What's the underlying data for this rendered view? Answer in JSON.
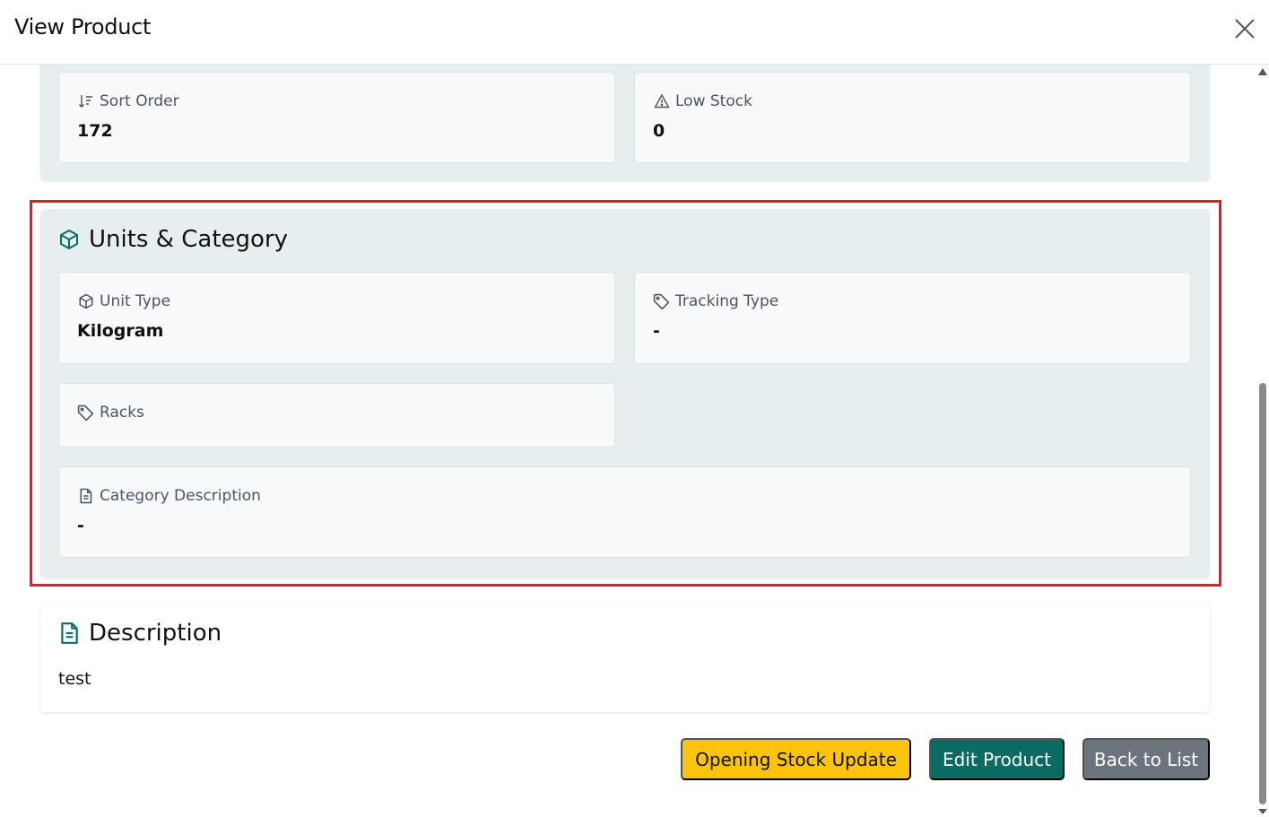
{
  "modal": {
    "title": "View Product"
  },
  "pricing_section": {
    "cards": [
      {
        "label": "Sort Order",
        "value": "172",
        "icon": "sort-icon"
      },
      {
        "label": "Low Stock",
        "value": "0",
        "icon": "warning-icon"
      }
    ]
  },
  "units_section": {
    "title": "Units & Category",
    "icon": "box-icon",
    "cards": [
      {
        "label": "Unit Type",
        "value": "Kilogram",
        "icon": "box-icon"
      },
      {
        "label": "Tracking Type",
        "value": "-",
        "icon": "tag-icon"
      },
      {
        "label": "Racks",
        "value": "",
        "icon": "tag-icon"
      },
      {
        "label": "Category Description",
        "value": "-",
        "icon": "document-icon"
      }
    ]
  },
  "description_section": {
    "title": "Description",
    "icon": "document-icon",
    "text": "test"
  },
  "actions": {
    "opening_stock": "Opening Stock Update",
    "edit": "Edit Product",
    "back": "Back to List"
  },
  "colors": {
    "accent": "#0b6b63",
    "warning": "#fbc30a",
    "secondary": "#6c757d",
    "highlight": "#e11d2a",
    "section_bg": "#e6eef0"
  }
}
